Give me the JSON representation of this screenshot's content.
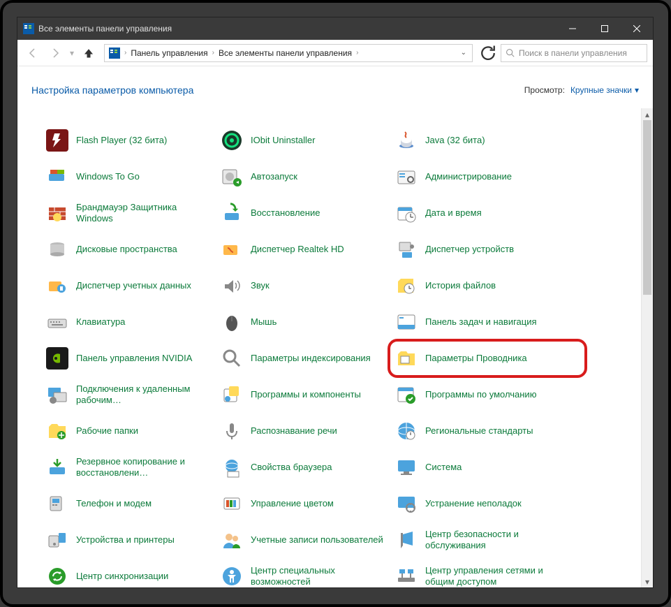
{
  "window": {
    "title": "Все элементы панели управления"
  },
  "breadcrumbs": {
    "part1": "Панель управления",
    "part2": "Все элементы панели управления"
  },
  "search": {
    "placeholder": "Поиск в панели управления"
  },
  "header": {
    "title": "Настройка параметров компьютера",
    "viewby_label": "Просмотр:",
    "viewby_value": "Крупные значки"
  },
  "items": [
    {
      "label": "Flash Player (32 бита)",
      "icon": "flash"
    },
    {
      "label": "IObit Uninstaller",
      "icon": "iobit"
    },
    {
      "label": "Java (32 бита)",
      "icon": "java"
    },
    {
      "label": "Windows To Go",
      "icon": "wingo"
    },
    {
      "label": "Автозапуск",
      "icon": "autoplay"
    },
    {
      "label": "Администрирование",
      "icon": "admin"
    },
    {
      "label": "Брандмауэр Защитника Windows",
      "icon": "firewall"
    },
    {
      "label": "Восстановление",
      "icon": "recovery"
    },
    {
      "label": "Дата и время",
      "icon": "datetime"
    },
    {
      "label": "Дисковые пространства",
      "icon": "storage"
    },
    {
      "label": "Диспетчер Realtek HD",
      "icon": "realtek"
    },
    {
      "label": "Диспетчер устройств",
      "icon": "devmgr"
    },
    {
      "label": "Диспетчер учетных данных",
      "icon": "cred"
    },
    {
      "label": "Звук",
      "icon": "sound"
    },
    {
      "label": "История файлов",
      "icon": "filehist"
    },
    {
      "label": "Клавиатура",
      "icon": "keyboard"
    },
    {
      "label": "Мышь",
      "icon": "mouse"
    },
    {
      "label": "Панель задач и навигация",
      "icon": "taskbar"
    },
    {
      "label": "Панель управления NVIDIA",
      "icon": "nvidia"
    },
    {
      "label": "Параметры индексирования",
      "icon": "indexing"
    },
    {
      "label": "Параметры Проводника",
      "icon": "explorer",
      "highlight": true
    },
    {
      "label": "Подключения к удаленным рабочим…",
      "icon": "remote"
    },
    {
      "label": "Программы и компоненты",
      "icon": "programs"
    },
    {
      "label": "Программы по умолчанию",
      "icon": "defaults"
    },
    {
      "label": "Рабочие папки",
      "icon": "workfolders"
    },
    {
      "label": "Распознавание речи",
      "icon": "speech"
    },
    {
      "label": "Региональные стандарты",
      "icon": "region"
    },
    {
      "label": "Резервное копирование и восстановлени…",
      "icon": "backup"
    },
    {
      "label": "Свойства браузера",
      "icon": "inetopt"
    },
    {
      "label": "Система",
      "icon": "system"
    },
    {
      "label": "Телефон и модем",
      "icon": "phone"
    },
    {
      "label": "Управление цветом",
      "icon": "color"
    },
    {
      "label": "Устранение неполадок",
      "icon": "trouble"
    },
    {
      "label": "Устройства и принтеры",
      "icon": "devices"
    },
    {
      "label": "Учетные записи пользователей",
      "icon": "users"
    },
    {
      "label": "Центр безопасности и обслуживания",
      "icon": "action"
    },
    {
      "label": "Центр синхронизации",
      "icon": "sync"
    },
    {
      "label": "Центр специальных возможностей",
      "icon": "ease"
    },
    {
      "label": "Центр управления сетями и общим доступом",
      "icon": "network"
    }
  ]
}
